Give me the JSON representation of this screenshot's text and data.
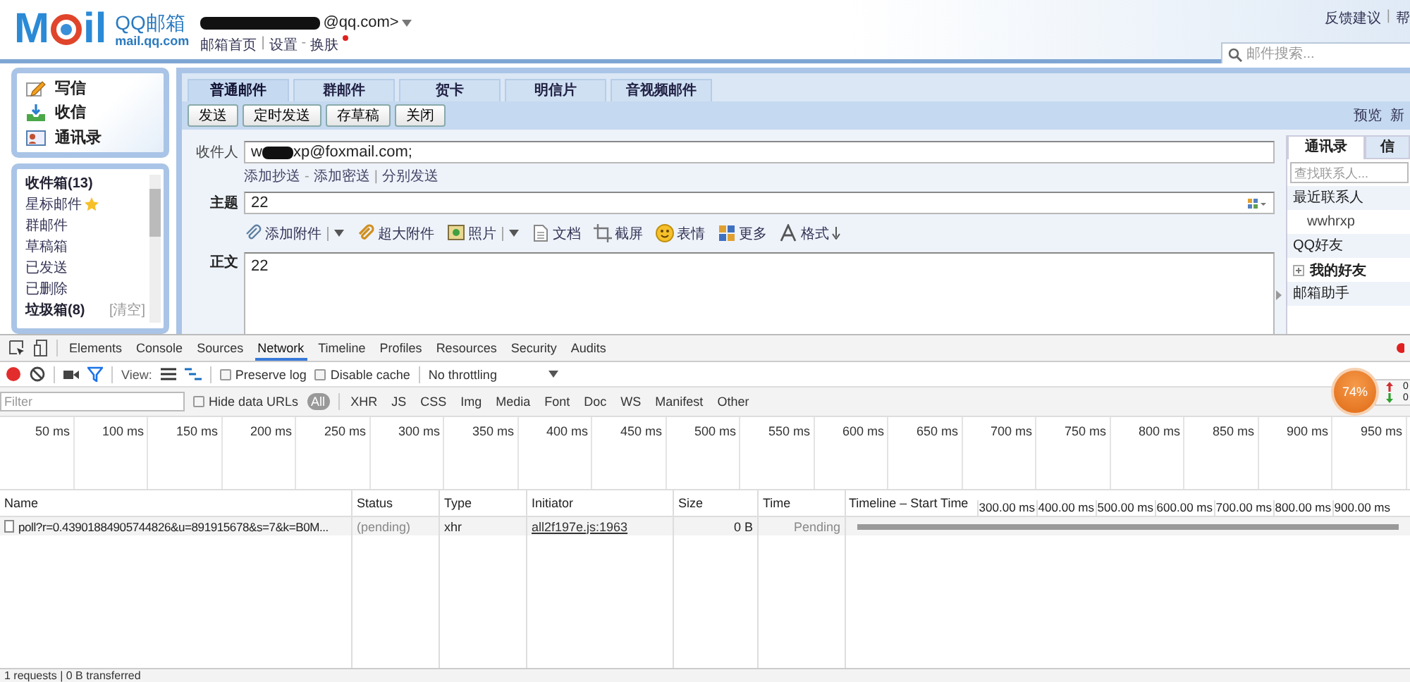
{
  "header": {
    "logo": {
      "left": "M",
      "right": "il",
      "name": "QQ邮箱",
      "domain": "mail.qq.com"
    },
    "account": "@qq.com>",
    "account_links": [
      {
        "label": "邮箱首页"
      },
      {
        "sep": "|",
        "label": "设置"
      },
      {
        "sep": "-",
        "label": "换肤"
      }
    ],
    "top_links": [
      {
        "label": "反馈建议"
      },
      {
        "sep": "|",
        "label": "帮"
      }
    ],
    "search": {
      "placeholder": "邮件搜索..."
    }
  },
  "sidebar": {
    "actions": [
      {
        "label": "写信",
        "kind": "write"
      },
      {
        "label": "收信",
        "kind": "receive"
      },
      {
        "label": "通讯录",
        "kind": "contacts"
      }
    ],
    "folders": [
      {
        "label": "收件箱(13)",
        "unread": true,
        "starred": false
      },
      {
        "label": "星标邮件",
        "unread": false,
        "starred": true
      },
      {
        "label": "群邮件",
        "unread": false,
        "starred": false
      },
      {
        "label": "草稿箱",
        "unread": false,
        "starred": false
      },
      {
        "label": "已发送",
        "unread": false,
        "starred": false
      },
      {
        "label": "已删除",
        "unread": false,
        "starred": false
      },
      {
        "label": "垃圾箱(8)",
        "unread": true,
        "starred": false,
        "action": "[清空]"
      }
    ]
  },
  "compose": {
    "tabs": [
      {
        "label": "普通邮件",
        "selected": true
      },
      {
        "label": "群邮件",
        "selected": false
      },
      {
        "label": "贺卡",
        "selected": false
      },
      {
        "label": "明信片",
        "selected": false
      },
      {
        "label": "音视频邮件",
        "selected": false
      }
    ],
    "buttons": [
      "发送",
      "定时发送",
      "存草稿",
      "关闭"
    ],
    "right_links": [
      "预览",
      "新"
    ],
    "recipient": {
      "label": "收件人",
      "value_start": "w",
      "value_end": "xp@foxmail.com;"
    },
    "recipient_links": [
      {
        "label": "添加抄送"
      },
      {
        "sep": "-",
        "label": "添加密送"
      },
      {
        "sep": "|",
        "label": "分别发送"
      }
    ],
    "subject": {
      "label": "主题",
      "value": "22"
    },
    "toolbar": [
      {
        "label": "添加附件",
        "kind": "attach",
        "dropdown": true
      },
      {
        "label": "超大附件",
        "kind": "bigattach",
        "dropdown": false
      },
      {
        "label": "照片",
        "kind": "photo",
        "dropdown": true
      },
      {
        "label": "文档",
        "kind": "doc",
        "dropdown": false
      },
      {
        "label": "截屏",
        "kind": "screenshot",
        "dropdown": false
      },
      {
        "label": "表情",
        "kind": "emoji",
        "dropdown": false
      },
      {
        "label": "更多",
        "kind": "more",
        "dropdown": false
      },
      {
        "label": "格式",
        "kind": "format",
        "dropdown": false
      }
    ],
    "body": {
      "label": "正文",
      "value": "22"
    },
    "contacts": {
      "tabs": [
        {
          "label": "通讯录",
          "selected": true
        },
        {
          "label": "信",
          "selected": false
        }
      ],
      "search": {
        "placeholder": "查找联系人..."
      },
      "items": [
        {
          "kind": "group",
          "label": "最近联系人"
        },
        {
          "kind": "contact",
          "label": "wwhrxp"
        },
        {
          "kind": "group",
          "label": "QQ好友"
        },
        {
          "kind": "folder",
          "label": "我的好友",
          "expanded": false
        },
        {
          "kind": "group",
          "label": "邮箱助手"
        }
      ]
    }
  },
  "devtools": {
    "tabs": [
      {
        "label": "Elements",
        "selected": false
      },
      {
        "label": "Console",
        "selected": false
      },
      {
        "label": "Sources",
        "selected": false
      },
      {
        "label": "Network",
        "selected": true
      },
      {
        "label": "Timeline",
        "selected": false
      },
      {
        "label": "Profiles",
        "selected": false
      },
      {
        "label": "Resources",
        "selected": false
      },
      {
        "label": "Security",
        "selected": false
      },
      {
        "label": "Audits",
        "selected": false
      }
    ],
    "toolbar": {
      "recording": true,
      "filter_on": true,
      "view_label": "View:",
      "preserve_log": {
        "label": "Preserve log",
        "checked": false
      },
      "disable_cache": {
        "label": "Disable cache",
        "checked": false
      },
      "throttling": "No throttling"
    },
    "filter_bar": {
      "placeholder": "Filter",
      "hide_data_urls": {
        "label": "Hide data URLs",
        "checked": false
      },
      "types": [
        {
          "label": "All",
          "selected": true
        },
        {
          "label": "XHR",
          "selected": false
        },
        {
          "label": "JS",
          "selected": false
        },
        {
          "label": "CSS",
          "selected": false
        },
        {
          "label": "Img",
          "selected": false
        },
        {
          "label": "Media",
          "selected": false
        },
        {
          "label": "Font",
          "selected": false
        },
        {
          "label": "Doc",
          "selected": false
        },
        {
          "label": "WS",
          "selected": false
        },
        {
          "label": "Manifest",
          "selected": false
        },
        {
          "label": "Other",
          "selected": false
        }
      ]
    },
    "overview_ticks": [
      "50 ms",
      "100 ms",
      "150 ms",
      "200 ms",
      "250 ms",
      "300 ms",
      "350 ms",
      "400 ms",
      "450 ms",
      "500 ms",
      "550 ms",
      "600 ms",
      "650 ms",
      "700 ms",
      "750 ms",
      "800 ms",
      "850 ms",
      "900 ms",
      "950 ms"
    ],
    "columns": [
      "Name",
      "Status",
      "Type",
      "Initiator",
      "Size",
      "Time",
      "Timeline – Start Time"
    ],
    "waterfall_ticks": [
      "300.00 ms",
      "400.00 ms",
      "500.00 ms",
      "600.00 ms",
      "700.00 ms",
      "800.00 ms",
      "900.00 ms"
    ],
    "requests": [
      {
        "name": "poll?r=0.43901884905744826&u=891915678&s=7&k=B0M...",
        "status": "(pending)",
        "type": "xhr",
        "initiator": "all2f197e.js:1963",
        "size": "0 B",
        "time": "Pending",
        "pending": true
      }
    ],
    "summary": "1 requests | 0 B transferred"
  },
  "overlay": {
    "percent": "74%",
    "up": "0",
    "down": "0"
  }
}
